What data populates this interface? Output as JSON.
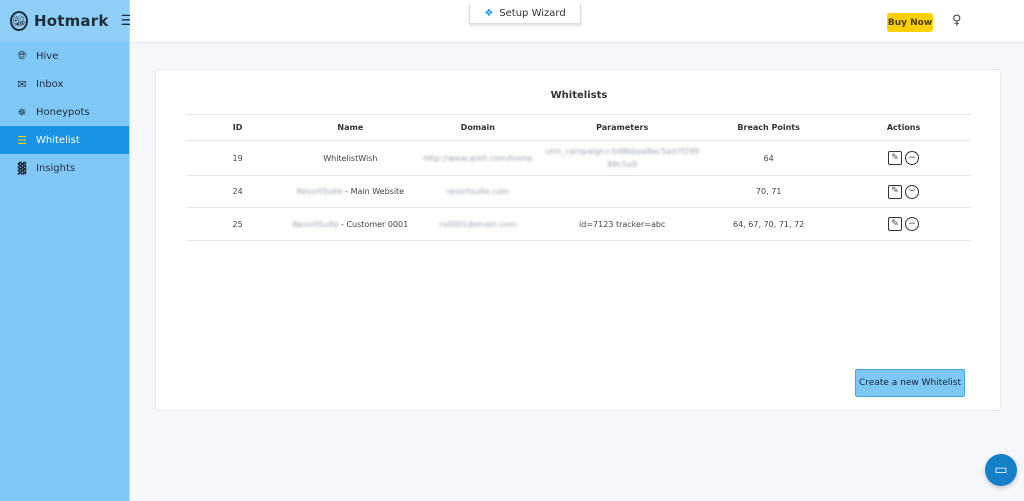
{
  "brand": {
    "name": "Hotmark",
    "logo_icon": "bee-icon",
    "menu_icon": "menu-icon"
  },
  "sidebar": {
    "items": [
      {
        "label": "Hive",
        "icon": "globe-icon",
        "active": false
      },
      {
        "label": "Inbox",
        "icon": "mail-icon",
        "active": false
      },
      {
        "label": "Honeypots",
        "icon": "bee-icon",
        "active": false
      },
      {
        "label": "Whitelist",
        "icon": "list-icon",
        "active": true
      },
      {
        "label": "Insights",
        "icon": "chart-icon",
        "active": false
      }
    ]
  },
  "topbar": {
    "wizard_label": "Setup Wizard",
    "buy_label": "Buy Now"
  },
  "card": {
    "title": "Whitelists",
    "columns": [
      "ID",
      "Name",
      "Domain",
      "Parameters",
      "Breach Points",
      "Actions"
    ],
    "rows": [
      {
        "id": "19",
        "name": "WhitelistWish",
        "domain": "http://www.wish.com/home",
        "parameters": "utm_campaign=5d8bbea9ec5ad7f29989c5a9",
        "breach_points": "64"
      },
      {
        "id": "24",
        "name_prefix": "ResortSuite",
        "name_suffix": " - Main Website",
        "domain": "resortsuite.com",
        "parameters": "",
        "breach_points": "70, 71"
      },
      {
        "id": "25",
        "name_prefix": "ResortSuite",
        "name_suffix": " - Customer 0001",
        "domain": "rs0001domain.com",
        "parameters": "id=7123 tracker=abc",
        "breach_points": "64, 67, 70, 71, 72"
      }
    ],
    "create_label": "Create a new Whitelist"
  },
  "colors": {
    "sidebar_bg": "#80c8f7",
    "active_bg": "#1794e6",
    "accent_yellow": "#ffd000"
  }
}
